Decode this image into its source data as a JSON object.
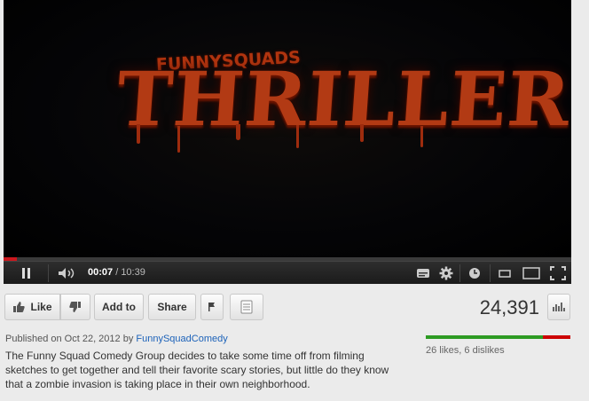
{
  "video": {
    "title_art": "THRILLER",
    "subtitle_art": "FUNNYSQUADS",
    "progress_fraction": 0.024,
    "current_time": "00:07",
    "duration": "10:39"
  },
  "actions": {
    "like_label": "Like",
    "add_to_label": "Add to",
    "share_label": "Share"
  },
  "views": "24,391",
  "published": {
    "prefix": "Published on Oct 22, 2012 by ",
    "channel": "FunnySquadComedy"
  },
  "description": "The Funny Squad Comedy Group decides to take some time off from filming sketches to get together and tell their favorite scary stories, but little do they know that a zombie invasion is taking place in their own neighborhood.",
  "ratings": {
    "text": "26 likes, 6 dislikes",
    "like_fraction": 0.8125,
    "like_color": "#2d9b23",
    "dislike_color": "#cc0000"
  }
}
